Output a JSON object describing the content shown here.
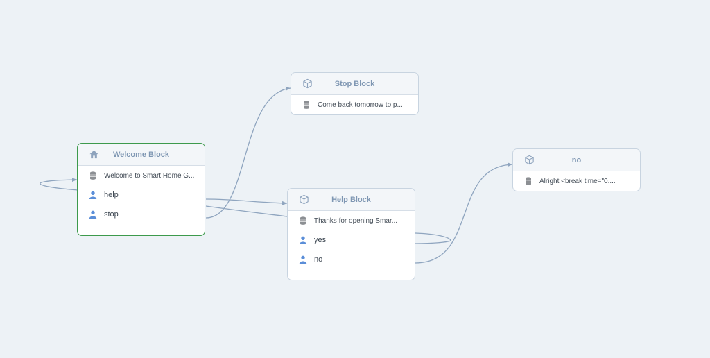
{
  "colors": {
    "background": "#edf2f6",
    "connector": "#8fa5bf",
    "selected_border": "#3d9a4c",
    "title": "#7f97b3",
    "user_icon": "#5b8ed8",
    "speech_icon": "#8c8f93"
  },
  "blocks": {
    "welcome": {
      "title": "Welcome Block",
      "icon": "home-icon",
      "rows": [
        {
          "type": "speech",
          "icon": "speech-icon",
          "label": "Welcome to Smart Home G..."
        },
        {
          "type": "intent",
          "icon": "user-icon",
          "label": "help"
        },
        {
          "type": "intent",
          "icon": "user-icon",
          "label": "stop"
        }
      ]
    },
    "stop": {
      "title": "Stop Block",
      "icon": "cube-icon",
      "rows": [
        {
          "type": "speech",
          "icon": "speech-icon",
          "label": "Come back tomorrow to p..."
        }
      ]
    },
    "help": {
      "title": "Help Block",
      "icon": "cube-icon",
      "rows": [
        {
          "type": "speech",
          "icon": "speech-icon",
          "label": "Thanks for opening Smar..."
        },
        {
          "type": "intent",
          "icon": "user-icon",
          "label": "yes"
        },
        {
          "type": "intent",
          "icon": "user-icon",
          "label": "no"
        }
      ]
    },
    "no": {
      "title": "no",
      "icon": "cube-icon",
      "rows": [
        {
          "type": "speech",
          "icon": "speech-icon",
          "label": "Alright <break time=\"0...."
        }
      ]
    }
  }
}
